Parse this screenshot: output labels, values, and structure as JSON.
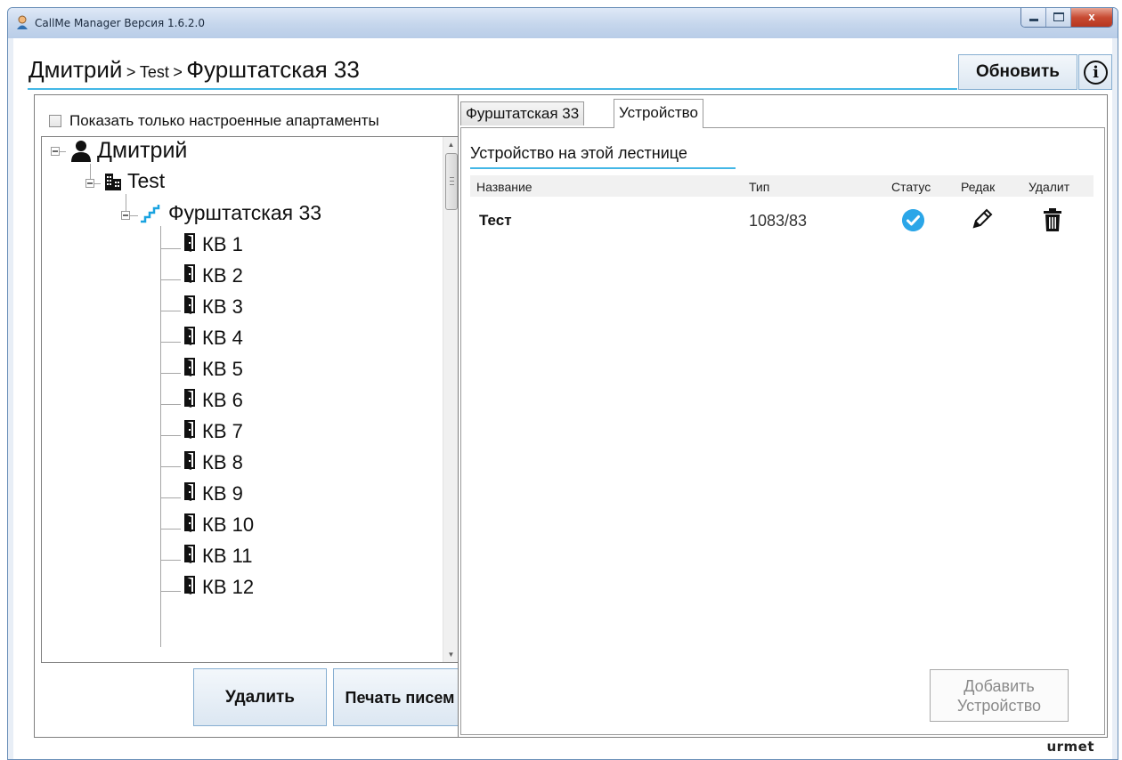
{
  "window": {
    "title": "CallMe Manager Версия 1.6.2.0",
    "close_glyph": "x"
  },
  "header": {
    "breadcrumb": [
      "Дмитрий",
      "Test",
      "Фурштатская 33"
    ],
    "separator": ">",
    "refresh_label": "Обновить",
    "info_glyph": "i"
  },
  "left": {
    "checkbox_label": "Показать только настроенные апартаменты",
    "checkbox_checked": false,
    "tree": {
      "root": "Дмитрий",
      "building": "Test",
      "staircase": "Фурштатская 33",
      "apartments": [
        "КВ 1",
        "КВ 2",
        "КВ 3",
        "КВ 4",
        "КВ 5",
        "КВ 6",
        "КВ 7",
        "КВ 8",
        "КВ 9",
        "КВ 10",
        "КВ 11",
        "КВ 12"
      ]
    },
    "delete_label": "Удалить",
    "print_label": "Печать писем",
    "scroll_up_glyph": "▲",
    "scroll_down_glyph": "▼"
  },
  "right": {
    "tabs": [
      "Фурштатская 33",
      "Устройство"
    ],
    "active_tab": "Устройство",
    "section_title": "Устройство на этой лестнице",
    "columns": [
      "Название",
      "Тип",
      "Статус",
      "Редак",
      "Удалит"
    ],
    "devices": [
      {
        "name": "Тест",
        "type": "1083/83",
        "status": "ok",
        "status_icon": "check-circle-icon",
        "edit_icon": "pencil-icon",
        "delete_icon": "trash-icon"
      }
    ],
    "add_label": "Добавить Устройство"
  },
  "footer": {
    "logo": "urmet"
  },
  "colors": {
    "accent": "#43b7e6",
    "status_ok": "#2ba6e8",
    "staircase_icon": "#1aa3e0",
    "button_border": "#86aed1"
  }
}
